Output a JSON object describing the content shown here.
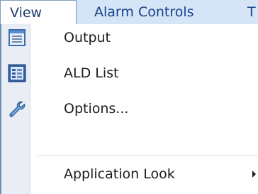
{
  "menubar": {
    "items": [
      {
        "label": "View"
      },
      {
        "label": "Alarm Controls"
      },
      {
        "label": "T"
      }
    ]
  },
  "menu": {
    "items": [
      {
        "label": "Output",
        "icon": "output-window-icon"
      },
      {
        "label": "ALD List",
        "icon": "ald-list-icon"
      },
      {
        "label": "Options...",
        "icon": "wrench-icon"
      },
      {
        "label": "Application Look",
        "icon": "",
        "has_submenu": true
      }
    ]
  }
}
